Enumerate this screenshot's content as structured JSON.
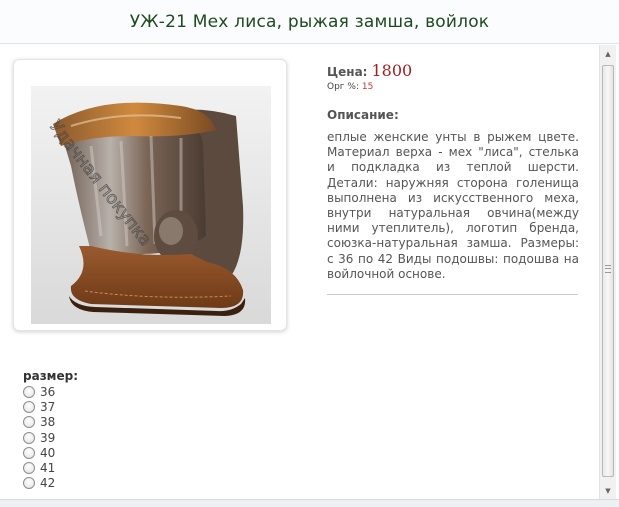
{
  "page": {
    "title": "УЖ-21 Мех лиса, рыжая замша, войлок"
  },
  "product": {
    "image_alt": "Унты из меха лисы с рыжей замшей",
    "price_label": "Цена:",
    "price_value": "1800",
    "org_label": "Орг %:",
    "org_value": "15",
    "description_label": "Описание:",
    "description": "еплые женские унты в рыжем цвете. Материал верха - мех \"лиса\", стелька и подкладка из теплой шерсти. Детали: наружняя сторона голенища выполнена из искусственного меха, внутри натуральная овчина(между ними утеплитель), логотип бренда, союзка-натуральная замша. Размеры: с 36 по 42 Виды подошвы: подошва на войлочной основе."
  },
  "sizes": {
    "label": "размер:",
    "options": [
      "36",
      "37",
      "38",
      "39",
      "40",
      "41",
      "42"
    ]
  },
  "colors": {
    "title": "#1f4a1f",
    "price": "#a31d1d",
    "org_value": "#c0392b",
    "text": "#555555"
  },
  "icons": {
    "scroll_up": "triangle-up-icon",
    "scroll_down": "triangle-down-icon"
  }
}
